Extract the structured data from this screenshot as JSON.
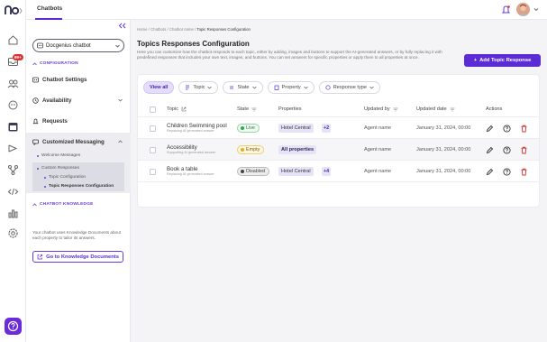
{
  "app": {
    "notification_badge": "99+",
    "tab_title": "Chatbots",
    "accent_color": "#5b2bd6"
  },
  "sidebar": {
    "bot_select": "Docgenius chatbot",
    "config_section": "CONFIGURATION",
    "items": [
      {
        "label": "Chatbot Settings"
      },
      {
        "label": "Availability"
      },
      {
        "label": "Requests"
      },
      {
        "label": "Customized Messaging"
      }
    ],
    "sub_items": [
      {
        "label": "Welcome Messages"
      },
      {
        "label": "Custom Responses"
      },
      {
        "label": "Topic Configuration"
      },
      {
        "label": "Topic Responses Configuration"
      }
    ],
    "knowledge_section": "CHATBOT KNOWLEDGE",
    "knowledge_text": "Your chatbot uses Knowledge Documents about each property to tailor its answers.",
    "knowledge_button": "Go to Knowledge Documents"
  },
  "breadcrumb": {
    "home": "Home",
    "sep": "/",
    "chatbots": "Chatbots",
    "chatbot_name": "Chatbot name",
    "current": "Topic Responses Configuration"
  },
  "page": {
    "title": "Topics Responses Configuration",
    "description": "Here you can customize how the chatbot responds to each topic, either by adding, images and buttons to support the AI-generated answers, or by fully replacing it with predefined responses that includes your own text, images, and buttons. You can set answers for specific properties or apply them to all properties at once.",
    "add_button": "Add Topic Response"
  },
  "filters": [
    "View all",
    "Topic",
    "State",
    "Property",
    "Response type"
  ],
  "table": {
    "headers": {
      "topic": "Topic",
      "state": "State",
      "properties": "Properties",
      "updated_by": "Updated by",
      "updated_date": "Updated date",
      "actions": "Actions"
    },
    "rows": [
      {
        "topic": "Children Swimming pool",
        "sub": "Replacing AI generated answer",
        "state": "Live",
        "property": "Hotel Central",
        "more": "+2",
        "updated_by": "Agent name",
        "updated_date": "January 31, 2024, 00:00"
      },
      {
        "topic": "Accessibility",
        "sub": "Supporting AI generated answer",
        "state": "Empty",
        "property": "All properties",
        "more": "",
        "updated_by": "Agent name",
        "updated_date": "January 31, 2024, 00:00"
      },
      {
        "topic": "Book a table",
        "sub": "Replacing AI generated answer",
        "state": "Disabled",
        "property": "Hotel Central",
        "more": "+4",
        "updated_by": "Agent name",
        "updated_date": "January 31, 2024, 00:00"
      }
    ]
  },
  "icons": {
    "rail": [
      "home-icon",
      "inbox-icon",
      "contacts-icon",
      "bot-icon",
      "calendar-icon",
      "campaign-icon",
      "flow-icon",
      "code-icon",
      "reports-icon",
      "settings-icon",
      "help-icon"
    ]
  }
}
